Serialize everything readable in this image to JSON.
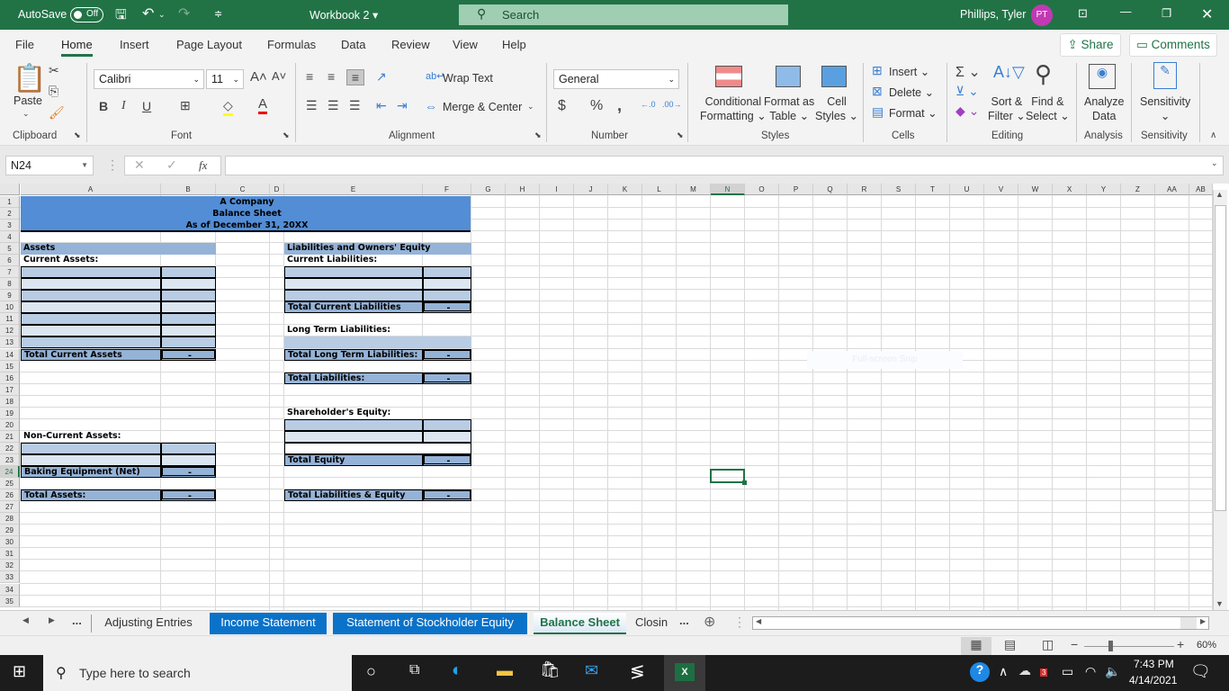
{
  "titlebar": {
    "autosave_label": "AutoSave",
    "autosave_state": "Off",
    "workbook": "Workbook 2",
    "search_placeholder": "Search",
    "user_name": "Phillips, Tyler",
    "user_initials": "PT"
  },
  "menu": {
    "items": [
      "File",
      "Home",
      "Insert",
      "Page Layout",
      "Formulas",
      "Data",
      "Review",
      "View",
      "Help"
    ],
    "active": "Home",
    "share": "Share",
    "comments": "Comments"
  },
  "ribbon": {
    "clipboard": {
      "paste": "Paste",
      "group": "Clipboard"
    },
    "font": {
      "name": "Calibri",
      "size": "11",
      "group": "Font"
    },
    "alignment": {
      "wrap": "Wrap Text",
      "merge": "Merge & Center",
      "group": "Alignment"
    },
    "number": {
      "format": "General",
      "group": "Number"
    },
    "styles": {
      "conditional": "Conditional",
      "conditional2": "Formatting",
      "format_table": "Format as",
      "format_table2": "Table",
      "cell_styles": "Cell",
      "cell_styles2": "Styles",
      "group": "Styles"
    },
    "cells": {
      "insert": "Insert",
      "delete": "Delete",
      "format": "Format",
      "group": "Cells"
    },
    "editing": {
      "sort": "Sort &",
      "sort2": "Filter",
      "find": "Find &",
      "find2": "Select",
      "group": "Editing"
    },
    "analysis": {
      "analyze": "Analyze",
      "analyze2": "Data",
      "group": "Analysis"
    },
    "sensitivity": {
      "label": "Sensitivity",
      "group": "Sensitivity"
    }
  },
  "formula_bar": {
    "name_box": "N24",
    "fx": "fx",
    "formula": ""
  },
  "sheet": {
    "columns": [
      "A",
      "B",
      "C",
      "D",
      "E",
      "F",
      "G",
      "H",
      "I",
      "J",
      "K",
      "L",
      "M",
      "N",
      "O",
      "P",
      "Q",
      "R",
      "S",
      "T",
      "U",
      "V",
      "W",
      "X",
      "Y",
      "Z",
      "AA",
      "AB"
    ],
    "selected_column": "N",
    "selected_row": 24,
    "rows": [
      "1",
      "2",
      "3",
      "4",
      "5",
      "6",
      "7",
      "8",
      "9",
      "10",
      "11",
      "12",
      "13",
      "14",
      "15",
      "16",
      "17",
      "18",
      "19",
      "20",
      "21",
      "22",
      "23",
      "24",
      "25",
      "26",
      "27",
      "28",
      "29",
      "30",
      "31",
      "32",
      "33",
      "34",
      "35"
    ],
    "header": {
      "company": "A Company",
      "title": "Balance Sheet",
      "date": "As of December 31, 20XX"
    },
    "assets": {
      "heading": "Assets",
      "current": "Current Assets:",
      "total_current": "Total Current Assets",
      "non_current": "Non-Current Assets:",
      "baking": "Baking Equipment (Net)",
      "total": "Total Assets:"
    },
    "liabilities": {
      "heading": "Liabilities and Owners' Equity",
      "current": "Current Liabilities:",
      "total_current": "Total Current Liabilities",
      "long_term": "Long Term Liabilities:",
      "total_long": "Total Long Term Liabilities:",
      "total": "Total Liabilities:",
      "equity": "Shareholder's Equity:",
      "total_equity": "Total Equity",
      "total_le": "Total Liabilities & Equity"
    },
    "dash": "-",
    "snip_hint": "Full-screen Snip"
  },
  "tabs": {
    "items": [
      "Adjusting Entries",
      "Income Statement",
      "Statement of Stockholder Equity",
      "Balance Sheet",
      "Closin"
    ],
    "active": "Balance Sheet",
    "more": "...",
    "ellipsis": "..."
  },
  "status": {
    "zoom": "60%"
  },
  "taskbar": {
    "search_placeholder": "Type here to search",
    "time": "7:43 PM",
    "date": "4/14/2021",
    "badge": "3"
  }
}
